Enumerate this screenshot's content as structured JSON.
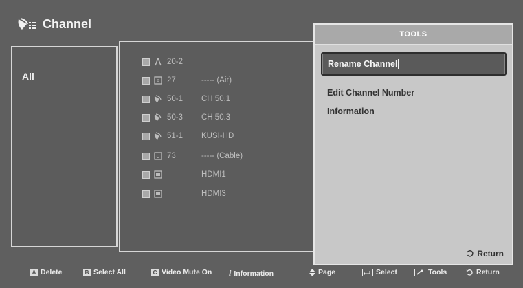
{
  "header": {
    "title": "Channel",
    "icon": "satellite-dish-icon"
  },
  "category": {
    "label": "All"
  },
  "channels": [
    {
      "number": "20-2",
      "name": "",
      "type_icon": "antenna-icon"
    },
    {
      "number": "27",
      "name": "----- (Air)",
      "type_icon": "air-icon"
    },
    {
      "number": "50-1",
      "name": "CH 50.1",
      "type_icon": "satellite-icon"
    },
    {
      "number": "50-3",
      "name": "CH 50.3",
      "type_icon": "satellite-icon"
    },
    {
      "number": "51-1",
      "name": "KUSI-HD",
      "type_icon": "satellite-icon"
    },
    {
      "number": "73",
      "name": "----- (Cable)",
      "type_icon": "air-icon"
    },
    {
      "number": "",
      "name": "HDMI1",
      "type_icon": "hdmi-icon"
    },
    {
      "number": "",
      "name": "HDMI3",
      "type_icon": "hdmi-icon"
    }
  ],
  "tools": {
    "title": "TOOLS",
    "items": [
      "Rename Channel",
      "Edit Channel Number",
      "Information"
    ],
    "selected_index": 0,
    "return_label": "Return"
  },
  "footer": {
    "delete": {
      "key": "A",
      "label": "Delete"
    },
    "select_all": {
      "key": "B",
      "label": "Select All"
    },
    "video_mute": {
      "key": "C",
      "label": "Video Mute On"
    },
    "information": {
      "key": "i",
      "label": "Information"
    },
    "page": {
      "label": "Page"
    },
    "select": {
      "label": "Select"
    },
    "tools": {
      "label": "Tools"
    },
    "return": {
      "label": "Return"
    }
  },
  "colors": {
    "background": "#5f5f5f",
    "tools_panel": "#c8c8c8",
    "selected_item": "#5a5a5a"
  }
}
